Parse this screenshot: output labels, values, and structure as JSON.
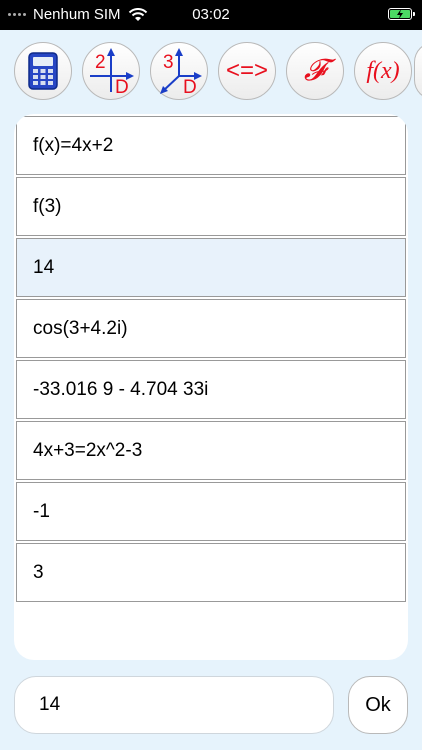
{
  "status_bar": {
    "carrier": "Nenhum SIM",
    "time": "03:02"
  },
  "toolbar": {
    "buttons": [
      {
        "name": "calculator",
        "icon": "calculator-icon"
      },
      {
        "name": "plot-2d",
        "icon": "graph-2d-icon",
        "digit": "2",
        "letter": "D"
      },
      {
        "name": "plot-3d",
        "icon": "graph-3d-icon",
        "digit": "3",
        "letter": "D"
      },
      {
        "name": "equation",
        "icon": "equation-icon",
        "label": "<=>"
      },
      {
        "name": "function-f",
        "icon": "script-f-icon",
        "label": "𝓕"
      },
      {
        "name": "function-fx",
        "icon": "fx-icon",
        "label": "f(x)"
      }
    ],
    "colors": {
      "accent_red": "#e8101e",
      "accent_blue": "#1a3ec8"
    }
  },
  "history": [
    {
      "text": "f(x)=4x+2",
      "selected": false
    },
    {
      "text": "f(3)",
      "selected": false
    },
    {
      "text": "14",
      "selected": true
    },
    {
      "text": "cos(3+4.2i)",
      "selected": false
    },
    {
      "text": "-33.016 9 - 4.704 33i",
      "selected": false
    },
    {
      "text": "4x+3=2x^2-3",
      "selected": false
    },
    {
      "text": "-1",
      "selected": false
    },
    {
      "text": "3",
      "selected": false
    }
  ],
  "input": {
    "value": "14",
    "ok_label": "Ok"
  }
}
